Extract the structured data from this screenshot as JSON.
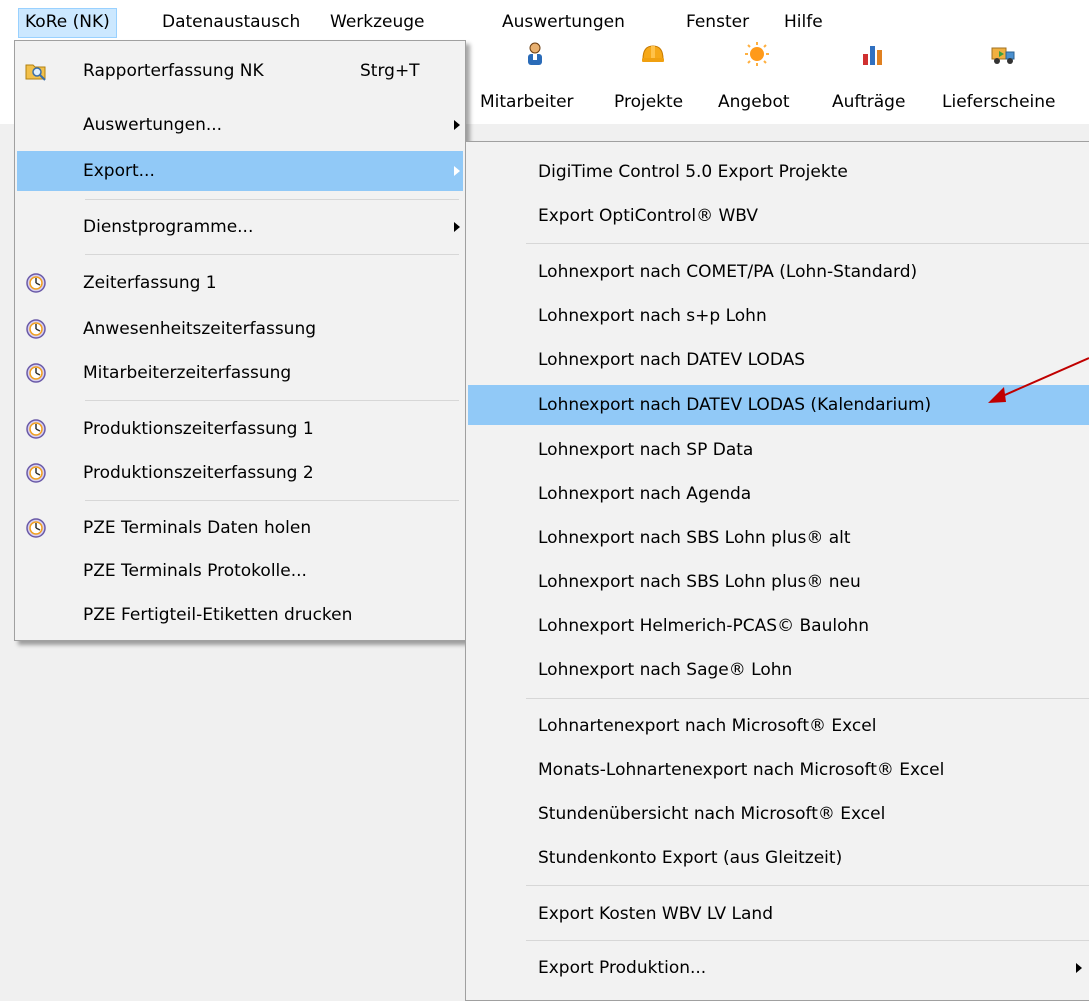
{
  "menubar": {
    "items": [
      "KoRe (NK)",
      "Datenaustausch",
      "Werkzeuge",
      "Auswertungen",
      "Fenster",
      "Hilfe"
    ]
  },
  "toolbar": {
    "buttons": [
      {
        "label": "Mitarbeiter",
        "icon": "person-icon"
      },
      {
        "label": "Projekte",
        "icon": "helmet-icon"
      },
      {
        "label": "Angebot",
        "icon": "sun-icon"
      },
      {
        "label": "Aufträge",
        "icon": "bar-chart-icon"
      },
      {
        "label": "Lieferscheine",
        "icon": "truck-icon"
      }
    ]
  },
  "main_menu": {
    "items": [
      {
        "label": "Rapporterfassung NK",
        "shortcut": "Strg+T",
        "icon": "magnifier-folder-icon"
      },
      {
        "label": "Auswertungen...",
        "submenu": true
      },
      {
        "label": "Export...",
        "submenu": true,
        "highlighted": true
      },
      {
        "label": "Dienstprogramme...",
        "submenu": true
      },
      {
        "label": "Zeiterfassung 1",
        "icon": "clock-icon"
      },
      {
        "label": "Anwesenheitszeiterfassung",
        "icon": "clock-icon"
      },
      {
        "label": "Mitarbeiterzeiterfassung",
        "icon": "clock-icon"
      },
      {
        "label": "Produktionszeiterfassung 1",
        "icon": "clock-icon"
      },
      {
        "label": "Produktionszeiterfassung 2",
        "icon": "clock-icon"
      },
      {
        "label": "PZE Terminals Daten holen",
        "icon": "clock-icon"
      },
      {
        "label": "PZE Terminals Protokolle..."
      },
      {
        "label": "PZE Fertigteil-Etiketten drucken"
      }
    ]
  },
  "export_menu": {
    "items": [
      "DigiTime Control 5.0 Export Projekte",
      "Export OptiControl® WBV",
      "Lohnexport nach COMET/PA (Lohn-Standard)",
      "Lohnexport nach s+p Lohn",
      "Lohnexport nach DATEV LODAS",
      "Lohnexport nach DATEV LODAS (Kalendarium)",
      "Lohnexport nach SP Data",
      "Lohnexport nach Agenda",
      "Lohnexport nach SBS Lohn plus® alt",
      "Lohnexport nach SBS Lohn plus® neu",
      "Lohnexport Helmerich-PCAS© Baulohn",
      "Lohnexport nach Sage® Lohn",
      "Lohnartenexport nach Microsoft® Excel",
      "Monats-Lohnartenexport nach Microsoft® Excel",
      "Stundenübersicht nach Microsoft® Excel",
      "Stundenkonto Export (aus Gleitzeit)",
      "Export Kosten WBV LV Land",
      "Export Produktion..."
    ],
    "highlighted_index": 5
  },
  "colors": {
    "highlight": "#91c9f7",
    "menubar_active": "#cce8ff",
    "annotation_arrow": "#c00000"
  }
}
